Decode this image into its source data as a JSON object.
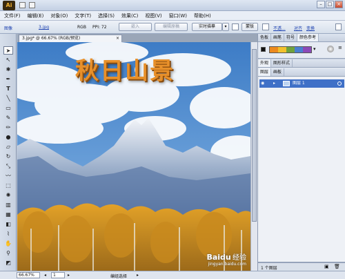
{
  "app": {
    "logo": "Ai"
  },
  "menu": [
    "文件(F)",
    "编辑(E)",
    "对象(O)",
    "文字(T)",
    "选择(S)",
    "效果(C)",
    "视图(V)",
    "窗口(W)",
    "帮助(H)"
  ],
  "control_bar": {
    "object_type": "图像",
    "filename": "3.jpg",
    "color_mode": "RGB",
    "ppi": "PPI: 72",
    "embed_button": "嵌入",
    "edit_original_button": "编辑原稿",
    "live_trace_button": "实时描摹",
    "mask_button": "蒙版",
    "opacity_link": "不透...",
    "align_link": "对齐",
    "transform_link": "变换"
  },
  "document": {
    "tab_title": "3.jpg* @ 66.67% (RGB/预览)",
    "tab_close": "×",
    "artwork_title": "秋日山景"
  },
  "status_bar": {
    "zoom": "66.67%",
    "page": "1",
    "tool_status": "编组选择"
  },
  "panels": {
    "color_tabs": [
      "色板",
      "画笔",
      "符号",
      "颜色参考"
    ],
    "appearance_tabs": [
      "外观",
      "图形样式"
    ],
    "layers_tabs": [
      "图层",
      "画板"
    ],
    "layer_name": "图层 1",
    "layer_count": "1 个图层"
  },
  "watermark": {
    "brand": "Baidu",
    "cn": "经验",
    "url": "jingyan.baidu.com"
  },
  "colors": {
    "accent": "#3f70c7",
    "title_orange": "#e8902a"
  }
}
